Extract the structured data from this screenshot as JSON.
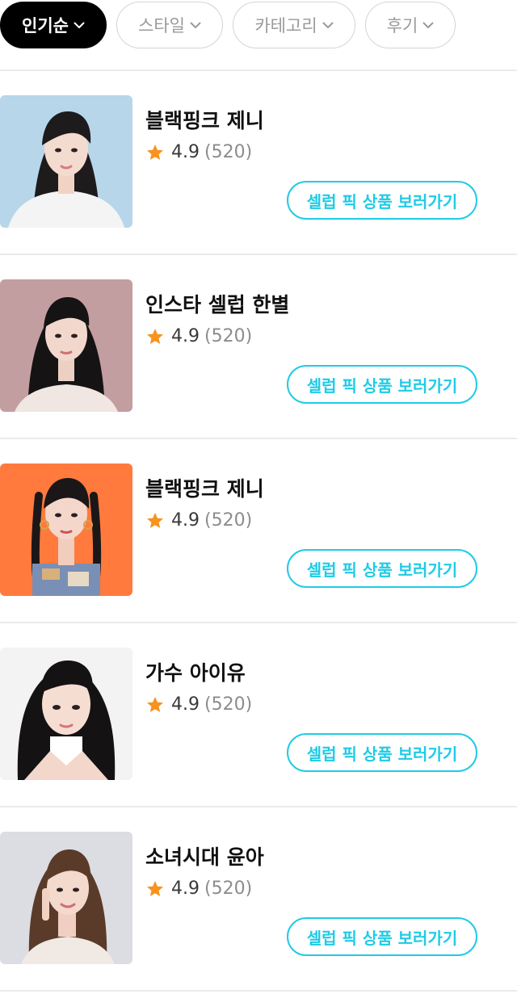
{
  "filters": [
    {
      "label": "인기순",
      "active": true
    },
    {
      "label": "스타일",
      "active": false
    },
    {
      "label": "카테고리",
      "active": false
    },
    {
      "label": "후기",
      "active": false
    }
  ],
  "colors": {
    "accent": "#1fcbe6",
    "star": "#f7931e",
    "active_chip": "#000000"
  },
  "items": [
    {
      "name": "블랙핑크 제니",
      "score": "4.9",
      "count": "(520)",
      "cta": "셀럽 픽 상품 보러가기",
      "image": "portrait-light-blue-bg"
    },
    {
      "name": "인스타 셀럽 한별",
      "score": "4.9",
      "count": "(520)",
      "cta": "셀럽 픽 상품 보러가기",
      "image": "portrait-mauve-bg"
    },
    {
      "name": "블랙핑크 제니",
      "score": "4.9",
      "count": "(520)",
      "cta": "셀럽 픽 상품 보러가기",
      "image": "portrait-orange-bg"
    },
    {
      "name": "가수 아이유",
      "score": "4.9",
      "count": "(520)",
      "cta": "셀럽 픽 상품 보러가기",
      "image": "portrait-white-bg"
    },
    {
      "name": "소녀시대 윤아",
      "score": "4.9",
      "count": "(520)",
      "cta": "셀럽 픽 상품 보러가기",
      "image": "portrait-gray-bg"
    }
  ]
}
